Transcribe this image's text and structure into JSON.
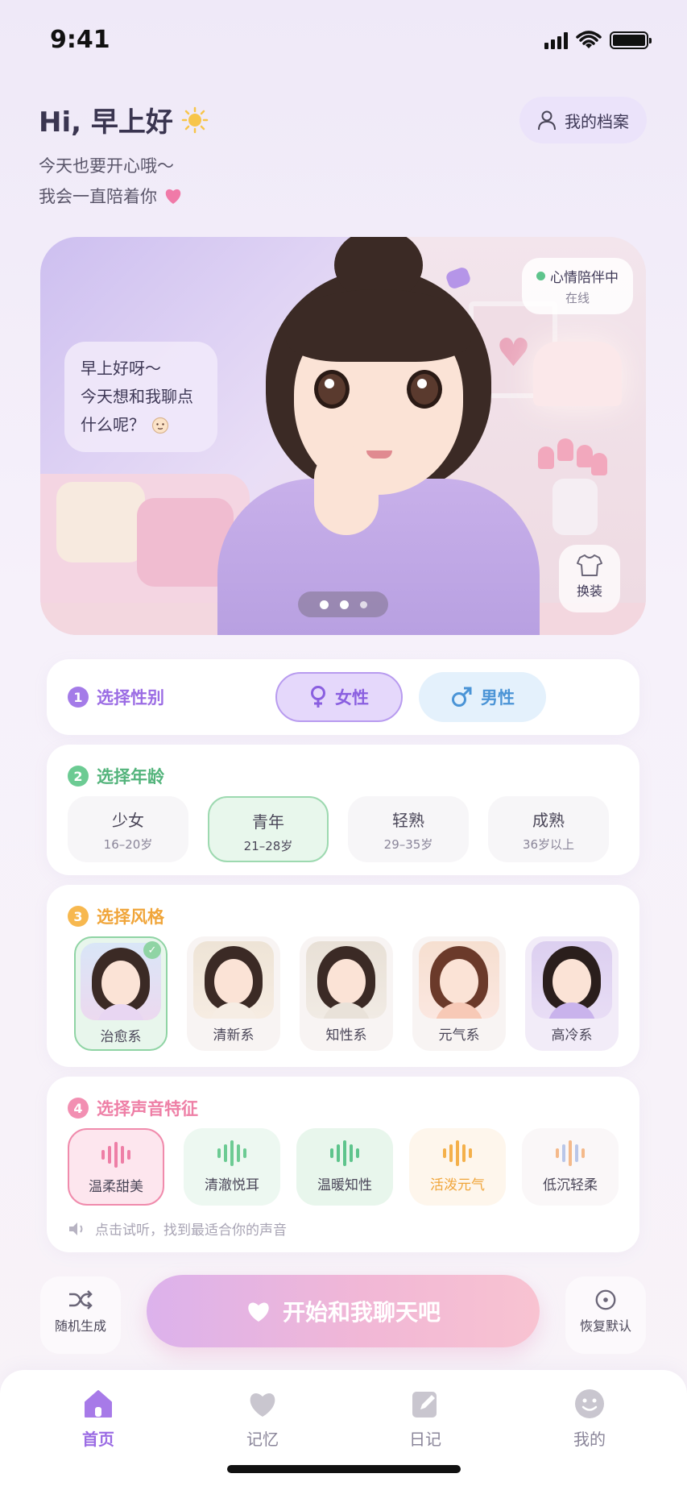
{
  "status": {
    "time": "9:41"
  },
  "header": {
    "greeting": "Hi, 早上好",
    "subtitle_line1": "今天也要开心哦～",
    "subtitle_line2": "我会一直陪着你",
    "profile_button": "我的档案"
  },
  "hero": {
    "speech_line1": "早上好呀～",
    "speech_line2": "今天想和我聊点",
    "speech_line3": "什么呢？",
    "mood_title": "心情陪伴中",
    "mood_status": "在线",
    "dress_button": "换装",
    "carousel_page": "1 / 3"
  },
  "gender": {
    "number": "1",
    "title": "选择性别",
    "options": [
      {
        "label": "女性",
        "selected": true
      },
      {
        "label": "男性",
        "selected": false
      }
    ]
  },
  "age": {
    "number": "2",
    "title": "选择年龄",
    "options": [
      {
        "label": "少女",
        "range": "16–20岁",
        "selected": false
      },
      {
        "label": "青年",
        "range": "21–28岁",
        "selected": true
      },
      {
        "label": "轻熟",
        "range": "29–35岁",
        "selected": false
      },
      {
        "label": "成熟",
        "range": "36岁以上",
        "selected": false
      }
    ]
  },
  "style": {
    "number": "3",
    "title": "选择风格",
    "options": [
      {
        "label": "治愈系",
        "selected": true
      },
      {
        "label": "清新系",
        "selected": false
      },
      {
        "label": "知性系",
        "selected": false
      },
      {
        "label": "元气系",
        "selected": false
      },
      {
        "label": "高冷系",
        "selected": false
      }
    ]
  },
  "voice": {
    "number": "4",
    "title": "选择声音特征",
    "options": [
      {
        "label": "温柔甜美",
        "selected": true
      },
      {
        "label": "清澈悦耳",
        "selected": false
      },
      {
        "label": "温暖知性",
        "selected": false
      },
      {
        "label": "活泼元气",
        "selected": false
      },
      {
        "label": "低沉轻柔",
        "selected": false
      }
    ],
    "hint": "点击试听，找到最适合你的声音"
  },
  "actions": {
    "random": "随机生成",
    "start": "开始和我聊天吧",
    "reset": "恢复默认"
  },
  "tabs": [
    {
      "label": "首页",
      "icon": "home-icon",
      "active": true
    },
    {
      "label": "记忆",
      "icon": "heart-icon",
      "active": false
    },
    {
      "label": "日记",
      "icon": "edit-icon",
      "active": false
    },
    {
      "label": "我的",
      "icon": "smile-icon",
      "active": false
    }
  ],
  "colors": {
    "purple": "#9b6ce4",
    "green": "#5ec48c",
    "orange": "#f4b04a",
    "pink": "#ee7fa6",
    "blue": "#4a94d6"
  }
}
